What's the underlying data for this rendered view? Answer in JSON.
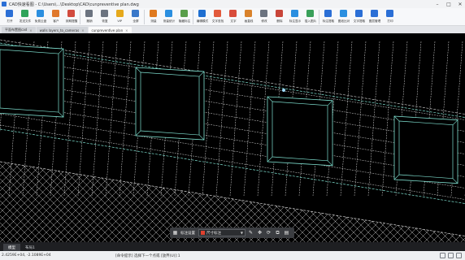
{
  "window": {
    "title": "CAD快速看图 - C:\\Users\\...\\Desktop\\CAD\\cunpreventive plan.dwg",
    "controls": [
      "minimize",
      "maximize",
      "close"
    ]
  },
  "ribbon": {
    "tools": [
      {
        "label": "打开",
        "icon": "folder-open-icon",
        "color": "#2b6fd6"
      },
      {
        "label": "发送文件",
        "icon": "send-file-icon",
        "color": "#2fa35a"
      },
      {
        "label": "免费云盘",
        "icon": "cloud-drive-icon",
        "color": "#2b8fe0"
      },
      {
        "label": "客户",
        "icon": "customer-icon",
        "color": "#e0782b"
      },
      {
        "label": "到期提醒",
        "icon": "reminder-icon",
        "color": "#d24b3e"
      },
      {
        "label": "撤销",
        "icon": "undo-icon",
        "color": "#6b7380"
      },
      {
        "label": "恢复",
        "icon": "redo-icon",
        "color": "#6b7380"
      },
      {
        "label": "VIP",
        "icon": "vip-icon",
        "color": "#e6a91c"
      },
      {
        "label": "全屏",
        "icon": "fullscreen-icon",
        "color": "#3a78c9"
      },
      {
        "label": "测量",
        "icon": "measure-icon",
        "color": "#e07a1f"
      },
      {
        "label": "测量统计",
        "icon": "measure-stats-icon",
        "color": "#2b8fe0"
      },
      {
        "label": "隐藏标注",
        "icon": "hide-annotation-icon",
        "color": "#5a9e4b"
      },
      {
        "label": "编辑模式",
        "icon": "edit-mode-icon",
        "color": "#1f6fd1"
      },
      {
        "label": "文字查找",
        "icon": "text-search-icon",
        "color": "#e25a3c"
      },
      {
        "label": "文字",
        "icon": "text-icon",
        "color": "#d94c3b"
      },
      {
        "label": "画直线",
        "icon": "line-icon",
        "color": "#d9822b"
      },
      {
        "label": "修改",
        "icon": "modify-icon",
        "color": "#6b7380"
      },
      {
        "label": "删除",
        "icon": "delete-icon",
        "color": "#c9463a"
      },
      {
        "label": "标注显示",
        "icon": "annotation-display-icon",
        "color": "#2b8fe0"
      },
      {
        "label": "插入图片",
        "icon": "insert-image-icon",
        "color": "#3aa05a"
      },
      {
        "label": "标注提取",
        "icon": "annotation-extract-icon",
        "color": "#2b6fd6"
      },
      {
        "label": "图纸比对",
        "icon": "drawing-compare-icon",
        "color": "#2b8fe0"
      },
      {
        "label": "文字提取",
        "icon": "text-extract-icon",
        "color": "#2b6fd6"
      },
      {
        "label": "图层管理",
        "icon": "layer-manage-icon",
        "color": "#2b6fd6"
      },
      {
        "label": "打印",
        "icon": "print-icon",
        "color": "#2b6fd6"
      }
    ]
  },
  "doc_tabs": [
    {
      "label": "平面布置图cad",
      "active": false
    },
    {
      "label": "walls layers_to_cameras",
      "active": false
    },
    {
      "label": "cunpreventive plan",
      "active": true
    }
  ],
  "canvas": {
    "background": "#000000",
    "line_color": "#d8d8d8",
    "accent_color": "#7fe0d0"
  },
  "cad_toolbar": {
    "label": "标注设置",
    "layer_value": "尺寸标注",
    "layer_color": "#e0412e"
  },
  "layout_tabs": [
    {
      "label": "模型",
      "active": true
    },
    {
      "label": "布局1",
      "active": false
    }
  ],
  "status": {
    "coords": "2.4259E+04, -2.1089E+04",
    "message": "[命令提示] 选择下一个点或 [放弃(U)]:1"
  }
}
